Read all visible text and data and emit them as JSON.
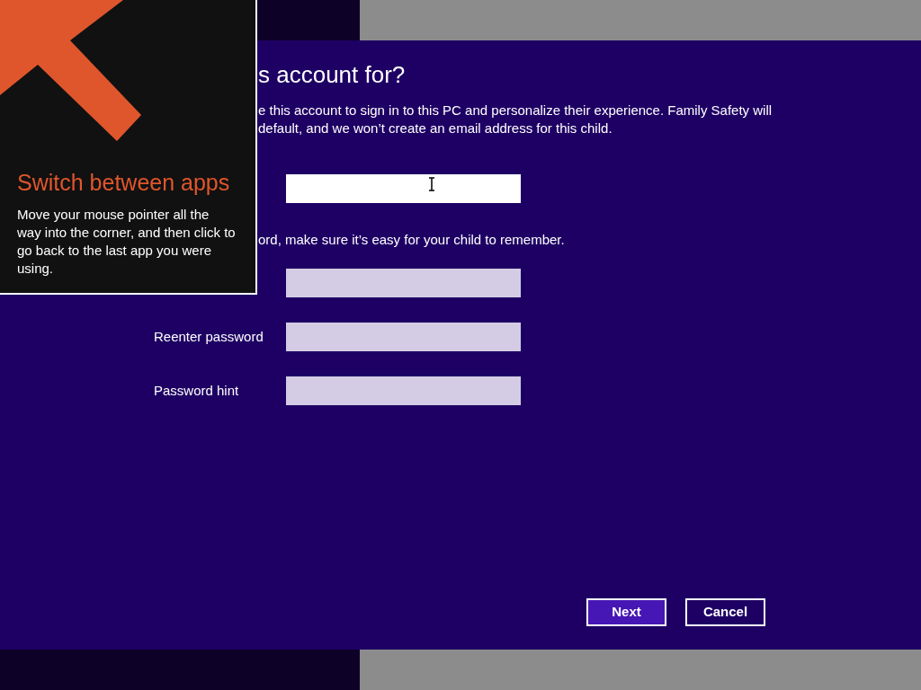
{
  "dialog": {
    "title": "s account for?",
    "description": [
      "e this account to sign in to this PC and personalize their experience. Family Safety will",
      "default, and we won’t create an email address for this child."
    ],
    "fields": [
      {
        "focused": true
      }
    ],
    "password_note": "ord, make sure it’s easy for your child to remember.",
    "password_fields": [
      {
        "focused": false
      },
      {
        "label": "Reenter password",
        "focused": false
      },
      {
        "label": "Password hint",
        "focused": false
      }
    ],
    "buttons": [
      {
        "label": "Next",
        "primary": true
      },
      {
        "label": "Cancel",
        "primary": false
      }
    ]
  },
  "tip": {
    "title": "Switch between apps",
    "body": "Move your mouse pointer all the way into the corner, and then click to go back to the last app you were using."
  }
}
